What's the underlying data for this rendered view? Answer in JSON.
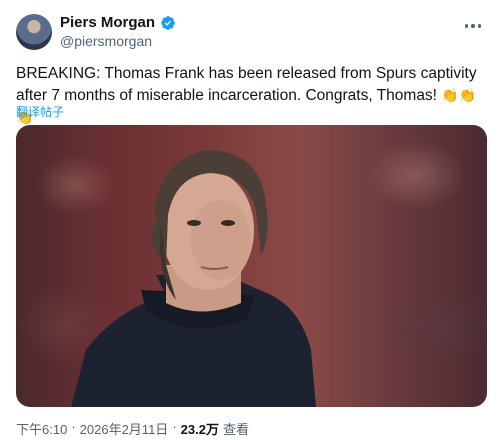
{
  "author": {
    "display_name": "Piers Morgan",
    "handle": "@piersmorgan",
    "verified": true
  },
  "tweet": {
    "text": "BREAKING: Thomas Frank has been released from Spurs captivity after 7 months of miserable incarceration. Congrats, Thomas!",
    "emoji": "👏👏👏",
    "translate_label": "翻译帖子"
  },
  "media": {
    "alt": "photo of a man with shoulder-length grey hair in a dark jacket at a stadium"
  },
  "footer": {
    "time": "下午6:10",
    "separator": "·",
    "date": "2026年2月11日",
    "views_count": "23.2万",
    "views_label": "查看"
  },
  "colors": {
    "accent": "#1d9bf0",
    "text": "#0f1419",
    "secondary": "#536471"
  }
}
